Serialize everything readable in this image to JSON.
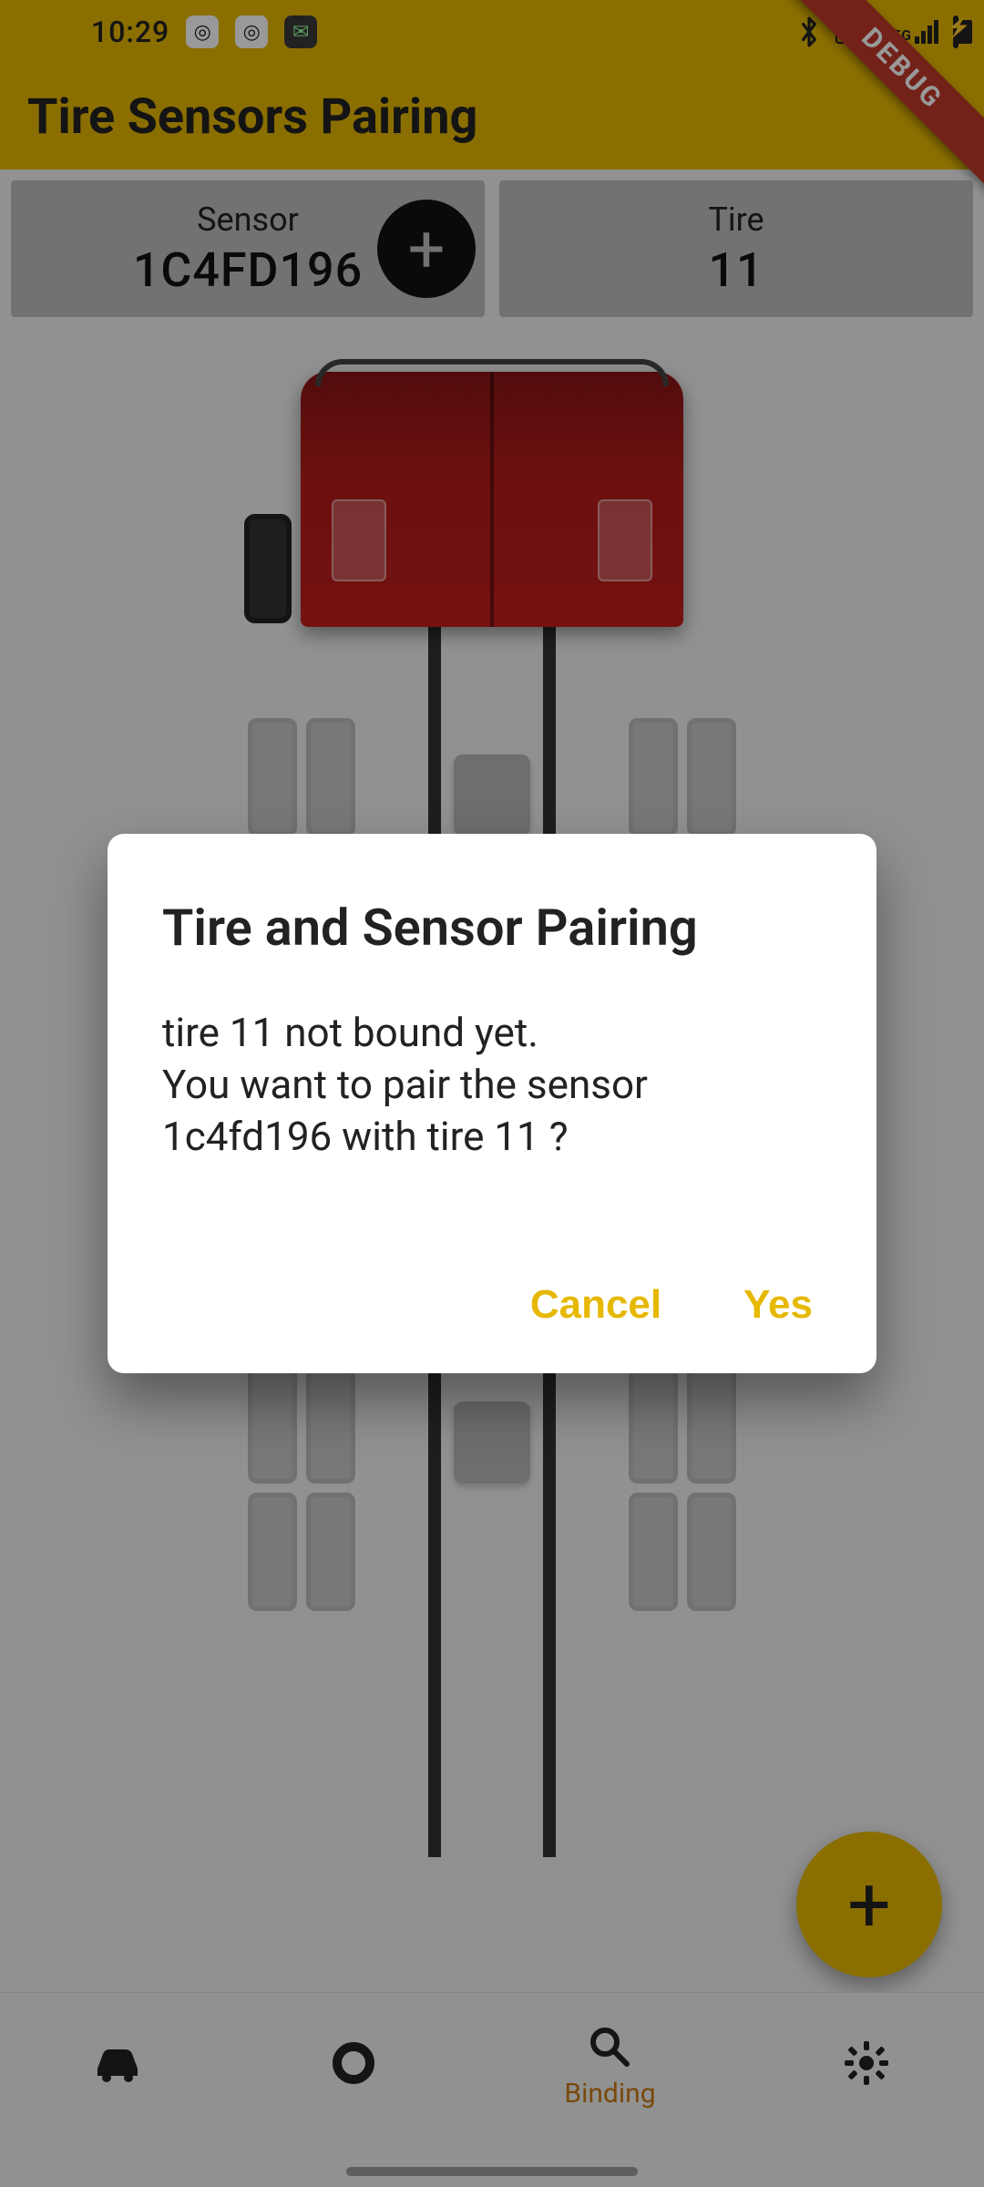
{
  "status": {
    "time": "10:29",
    "icons": [
      "app-dot-purple",
      "app-dot-purple2",
      "wechat"
    ],
    "right": {
      "bluetooth": true,
      "hd_label": "HD1",
      "net_label": "5G"
    }
  },
  "debug_banner": "DEBUG",
  "appbar": {
    "title": "Tire Sensors Pairing"
  },
  "cards": {
    "sensor": {
      "label": "Sensor",
      "value": "1C4FD196"
    },
    "tire": {
      "label": "Tire",
      "value": "11"
    }
  },
  "fab": {
    "icon": "plus"
  },
  "bottom_nav": {
    "items": [
      {
        "icon": "car",
        "label": ""
      },
      {
        "icon": "circle",
        "label": ""
      },
      {
        "icon": "search",
        "label": "Binding",
        "active": true
      },
      {
        "icon": "gear",
        "label": ""
      }
    ]
  },
  "dialog": {
    "title": "Tire and Sensor Pairing",
    "body": "tire 11 not bound yet.\nYou want to pair the sensor 1c4fd196 with tire 11 ?",
    "actions": {
      "cancel": "Cancel",
      "confirm": "Yes"
    }
  }
}
